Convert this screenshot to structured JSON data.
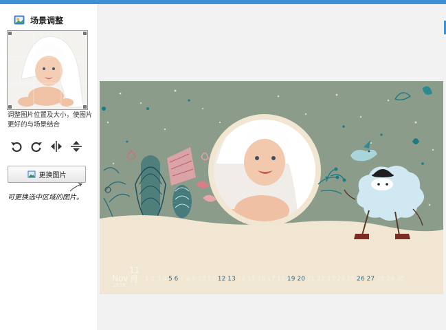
{
  "sidebar": {
    "title": "场景调整",
    "hint": "调整图片位置及大小，使图片更好的与场景结合",
    "replace_label": "更换图片",
    "note": "可更换选中区域的图片。",
    "tools": [
      {
        "name": "rotate-left-icon"
      },
      {
        "name": "rotate-right-icon"
      },
      {
        "name": "flip-horizontal-icon"
      },
      {
        "name": "flip-vertical-icon"
      }
    ]
  },
  "calendar": {
    "month_en": "Nov",
    "year": "2016",
    "month_cn": "11月",
    "days": [
      {
        "n": "1",
        "alt": false
      },
      {
        "n": "2",
        "alt": false
      },
      {
        "n": "3",
        "alt": false
      },
      {
        "n": "4",
        "alt": false
      },
      {
        "n": "5",
        "alt": true
      },
      {
        "n": "6",
        "alt": true
      },
      {
        "n": "7",
        "alt": false
      },
      {
        "n": "8",
        "alt": false
      },
      {
        "n": "9",
        "alt": false
      },
      {
        "n": "10",
        "alt": false
      },
      {
        "n": "11",
        "alt": false
      },
      {
        "n": "12",
        "alt": true
      },
      {
        "n": "13",
        "alt": true
      },
      {
        "n": "14",
        "alt": false
      },
      {
        "n": "15",
        "alt": false
      },
      {
        "n": "16",
        "alt": false
      },
      {
        "n": "17",
        "alt": false
      },
      {
        "n": "18",
        "alt": false
      },
      {
        "n": "19",
        "alt": true
      },
      {
        "n": "20",
        "alt": true
      },
      {
        "n": "21",
        "alt": false
      },
      {
        "n": "22",
        "alt": false
      },
      {
        "n": "23",
        "alt": false
      },
      {
        "n": "24",
        "alt": false
      },
      {
        "n": "25",
        "alt": false
      },
      {
        "n": "26",
        "alt": true
      },
      {
        "n": "27",
        "alt": true
      },
      {
        "n": "28",
        "alt": false
      },
      {
        "n": "29",
        "alt": false
      },
      {
        "n": "30",
        "alt": false
      }
    ]
  },
  "colors": {
    "accent": "#3d8fd6",
    "scene_bg": "#8c9c8a",
    "ground": "#f1e6d2",
    "weekend": "#2e6b8a"
  }
}
